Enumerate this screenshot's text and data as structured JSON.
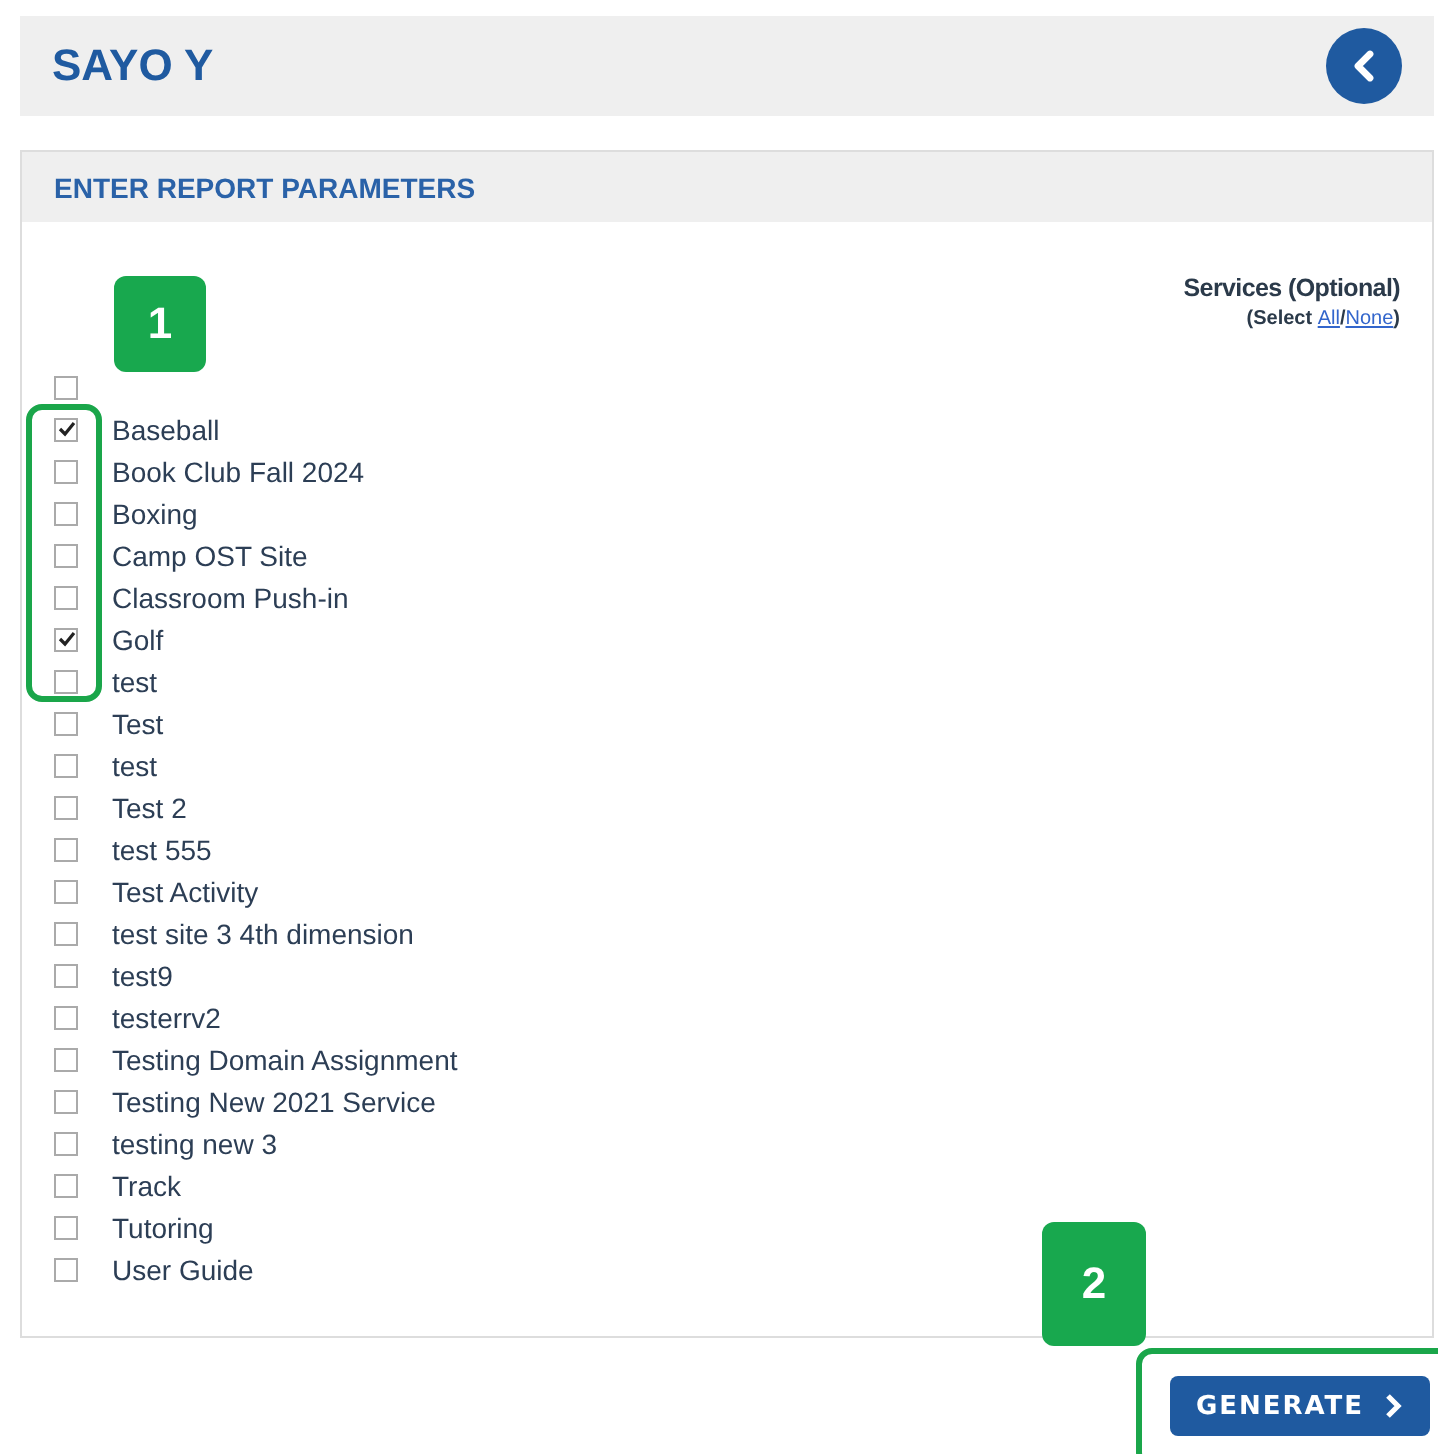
{
  "header": {
    "title": "SAYO Y"
  },
  "panel": {
    "title": "ENTER REPORT PARAMETERS"
  },
  "services": {
    "label": "Services (Optional)",
    "select_prefix": "(Select ",
    "select_all": "All",
    "separator": "/",
    "select_none": "None",
    "select_suffix": ")",
    "blank_checkbox": {
      "checked": false
    },
    "items": [
      {
        "label": "Baseball",
        "checked": true
      },
      {
        "label": "Book Club Fall 2024",
        "checked": false
      },
      {
        "label": "Boxing",
        "checked": false
      },
      {
        "label": "Camp OST Site",
        "checked": false
      },
      {
        "label": "Classroom Push-in",
        "checked": false
      },
      {
        "label": "Golf",
        "checked": true
      },
      {
        "label": "test",
        "checked": false
      },
      {
        "label": "Test",
        "checked": false
      },
      {
        "label": "test",
        "checked": false
      },
      {
        "label": "Test 2",
        "checked": false
      },
      {
        "label": "test 555",
        "checked": false
      },
      {
        "label": "Test Activity",
        "checked": false
      },
      {
        "label": "test site 3 4th dimension",
        "checked": false
      },
      {
        "label": "test9",
        "checked": false
      },
      {
        "label": "testerrv2",
        "checked": false
      },
      {
        "label": "Testing Domain Assignment",
        "checked": false
      },
      {
        "label": "Testing New 2021 Service",
        "checked": false
      },
      {
        "label": "testing new 3",
        "checked": false
      },
      {
        "label": "Track",
        "checked": false
      },
      {
        "label": "Tutoring",
        "checked": false
      },
      {
        "label": "User Guide",
        "checked": false
      }
    ]
  },
  "generate_button": {
    "label": "GENERATE"
  },
  "annotations": [
    {
      "label": "1"
    },
    {
      "label": "2"
    }
  ]
}
